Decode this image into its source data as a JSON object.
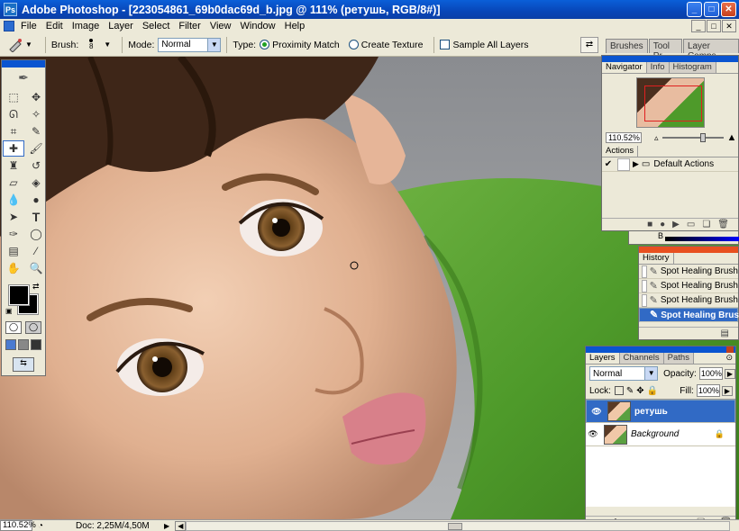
{
  "titlebar": {
    "logo": "Ps",
    "title": "Adobe Photoshop - [223054861_69b0dac69d_b.jpg @ 111% (ретушь, RGB/8#)]",
    "minimize": "_",
    "maximize": "□",
    "close": "✕"
  },
  "menubar": {
    "items": [
      "File",
      "Edit",
      "Image",
      "Layer",
      "Select",
      "Filter",
      "View",
      "Window",
      "Help"
    ],
    "mdi_min": "_",
    "mdi_restore": "□",
    "mdi_close": "✕"
  },
  "options": {
    "brush_label": "Brush:",
    "brush_size": "8",
    "mode_label": "Mode:",
    "mode_value": "Normal",
    "type_label": "Type:",
    "proximity_label": "Proximity Match",
    "texture_label": "Create Texture",
    "sample_all_label": "Sample All Layers"
  },
  "docked_tabs": [
    "Brushes",
    "Tool Pr",
    "Layer Comps"
  ],
  "navigator": {
    "tabs": [
      "Navigator",
      "Info",
      "Histogram"
    ],
    "zoom": "110.52%"
  },
  "actions": {
    "tab": "Actions",
    "set_name": "Default Actions"
  },
  "color": {
    "b_label": "B"
  },
  "history": {
    "tab": "History",
    "items": [
      "Spot Healing Brush",
      "Spot Healing Brush",
      "Spot Healing Brush",
      "Spot Healing Brush"
    ],
    "selected_index": 3
  },
  "layers": {
    "tabs": [
      "Layers",
      "Channels",
      "Paths"
    ],
    "blend_mode": "Normal",
    "opacity_label": "Opacity:",
    "opacity": "100%",
    "lock_label": "Lock:",
    "fill_label": "Fill:",
    "fill": "100%",
    "items": [
      {
        "name": "ретушь",
        "selected": true
      },
      {
        "name": "Background",
        "selected": false
      }
    ]
  },
  "statusbar": {
    "zoom": "110.52%",
    "doc": "Doc: 2,25M/4,50M"
  },
  "colors": {
    "titlebar": "#0a54d0",
    "panel_bg": "#ece9d8",
    "selection": "#316ac5",
    "foreground": "#000000",
    "background": "#ffffff"
  }
}
